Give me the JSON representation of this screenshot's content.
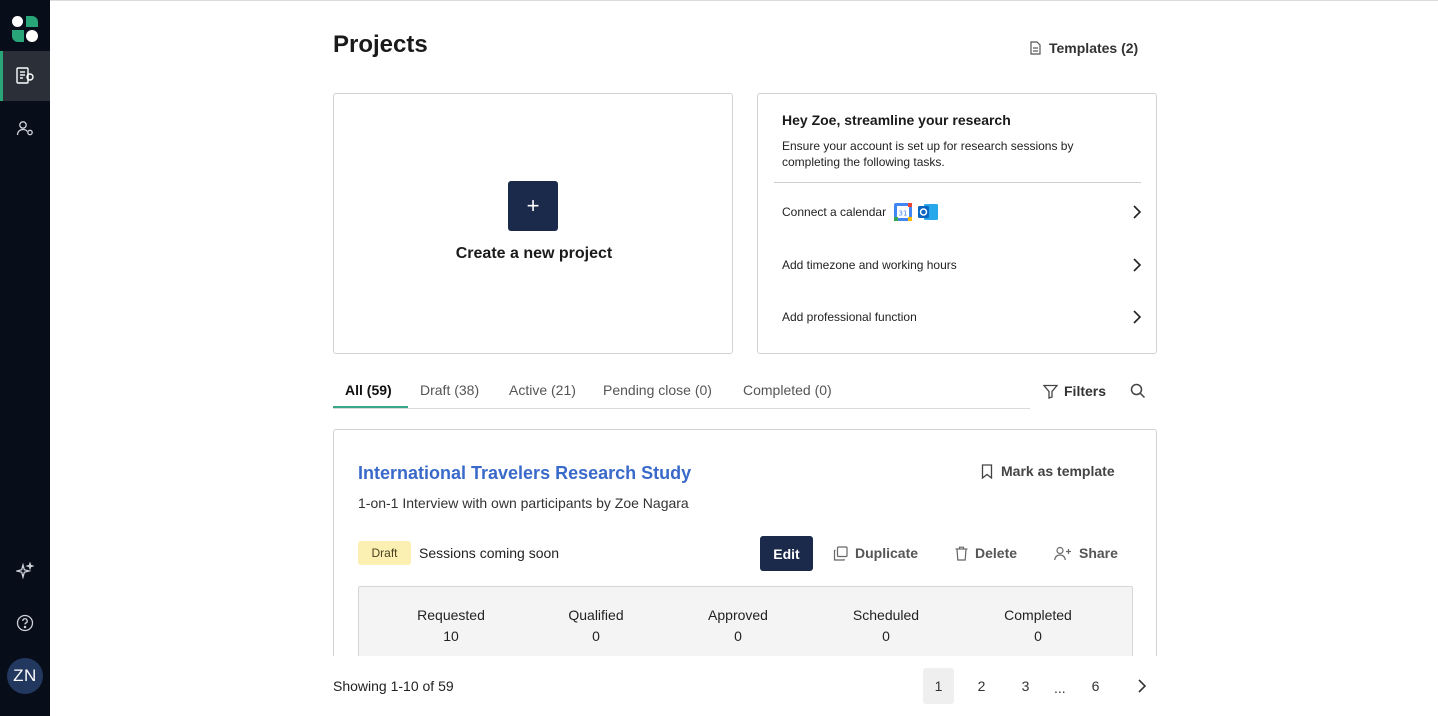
{
  "sidebar": {
    "avatar_initials": "ZN",
    "items": [
      {
        "name": "projects",
        "icon": "projects-icon",
        "active": true
      },
      {
        "name": "participants",
        "icon": "participants-icon",
        "active": false
      },
      {
        "name": "ai",
        "icon": "sparkle-icon",
        "active": false
      },
      {
        "name": "help",
        "icon": "help-icon",
        "active": false
      }
    ]
  },
  "header": {
    "title": "Projects",
    "templates_label": "Templates (2)"
  },
  "create_card": {
    "button_symbol": "+",
    "label": "Create a new project"
  },
  "setup_card": {
    "title": "Hey Zoe, streamline your research",
    "description": "Ensure your account is set up for research sessions by completing the following tasks.",
    "tasks": [
      {
        "label": "Connect a calendar"
      },
      {
        "label": "Add timezone and working hours"
      },
      {
        "label": "Add professional function"
      }
    ]
  },
  "tabs": [
    {
      "label": "All (59)",
      "active": true
    },
    {
      "label": "Draft (38)",
      "active": false
    },
    {
      "label": "Active (21)",
      "active": false
    },
    {
      "label": "Pending close (0)",
      "active": false
    },
    {
      "label": "Completed (0)",
      "active": false
    }
  ],
  "toolbar": {
    "filters_label": "Filters"
  },
  "project": {
    "title": "International Travelers Research Study",
    "subtitle": "1-on-1 Interview with own participants by Zoe Nagara",
    "mark_template_label": "Mark as template",
    "status_badge": "Draft",
    "sessions_text": "Sessions coming soon",
    "edit_label": "Edit",
    "duplicate_label": "Duplicate",
    "delete_label": "Delete",
    "share_label": "Share",
    "stats": [
      {
        "label": "Requested",
        "value": "10"
      },
      {
        "label": "Qualified",
        "value": "0"
      },
      {
        "label": "Approved",
        "value": "0"
      },
      {
        "label": "Scheduled",
        "value": "0"
      },
      {
        "label": "Completed",
        "value": "0"
      }
    ]
  },
  "pagination": {
    "showing": "Showing 1-10 of 59",
    "pages": [
      "1",
      "2",
      "3",
      "6"
    ],
    "ellipsis": "...",
    "current": "1"
  },
  "colors": {
    "sidebar_bg": "#070d19",
    "primary_button": "#1b2a4a",
    "link_blue": "#3a6ac9",
    "active_tab_underline": "#3aa68a",
    "draft_badge_bg": "#fbf0b2"
  }
}
